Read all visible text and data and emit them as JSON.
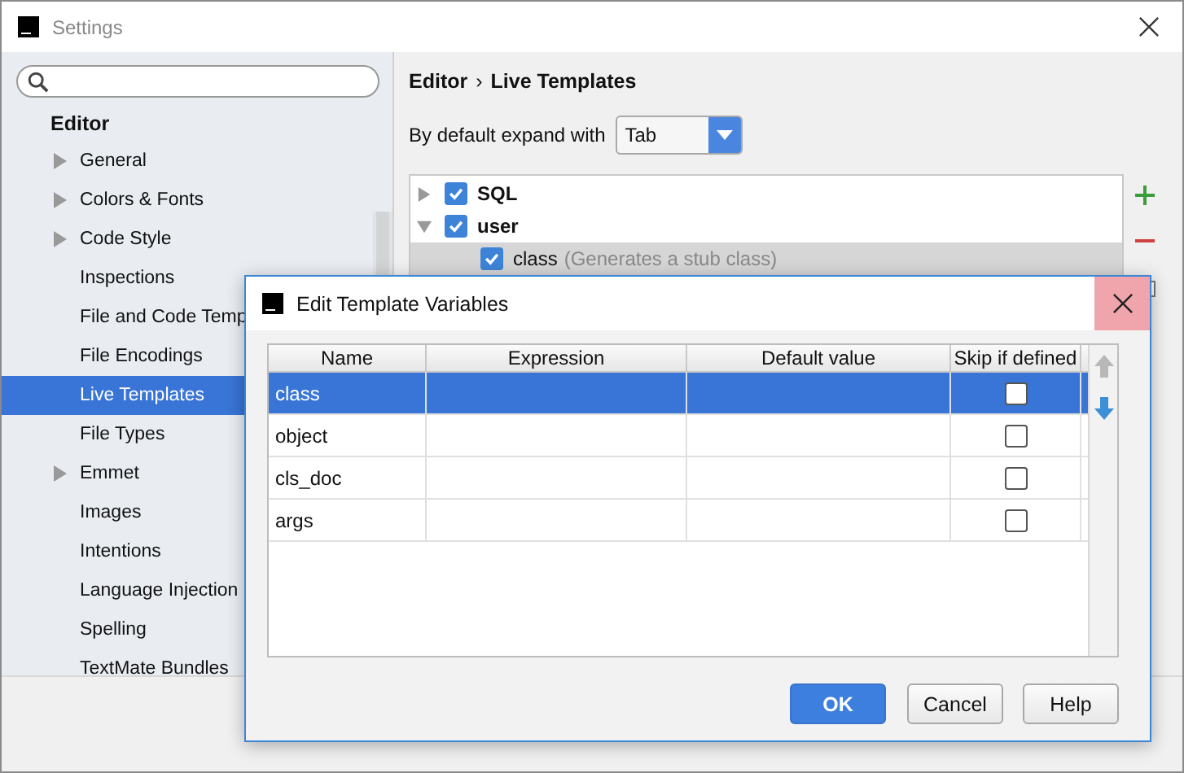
{
  "window": {
    "title": "Settings"
  },
  "sidebar": {
    "section": "Editor",
    "items": [
      {
        "label": "General",
        "expandable": true,
        "selected": false
      },
      {
        "label": "Colors & Fonts",
        "expandable": true,
        "selected": false
      },
      {
        "label": "Code Style",
        "expandable": true,
        "selected": false
      },
      {
        "label": "Inspections",
        "expandable": false,
        "selected": false
      },
      {
        "label": "File and Code Temp",
        "expandable": false,
        "selected": false
      },
      {
        "label": "File Encodings",
        "expandable": false,
        "selected": false
      },
      {
        "label": "Live Templates",
        "expandable": false,
        "selected": true
      },
      {
        "label": "File Types",
        "expandable": false,
        "selected": false
      },
      {
        "label": "Emmet",
        "expandable": true,
        "selected": false
      },
      {
        "label": "Images",
        "expandable": false,
        "selected": false
      },
      {
        "label": "Intentions",
        "expandable": false,
        "selected": false
      },
      {
        "label": "Language Injection",
        "expandable": false,
        "selected": false
      },
      {
        "label": "Spelling",
        "expandable": false,
        "selected": false
      },
      {
        "label": "TextMate Bundles",
        "expandable": false,
        "selected": false
      }
    ]
  },
  "breadcrumb": {
    "parent": "Editor",
    "separator": "›",
    "current": "Live Templates"
  },
  "expand_with": {
    "label": "By default expand with",
    "value": "Tab"
  },
  "templates": [
    {
      "name": "SQL",
      "checked": true,
      "expanded": false
    },
    {
      "name": "user",
      "checked": true,
      "expanded": true,
      "children": [
        {
          "name": "class",
          "description": "(Generates a stub class)",
          "checked": true,
          "selected": true
        }
      ]
    }
  ],
  "dialog": {
    "title": "Edit Template Variables",
    "columns": [
      "Name",
      "Expression",
      "Default value",
      "Skip if defined"
    ],
    "rows": [
      {
        "name": "class",
        "skip": false,
        "selected": true
      },
      {
        "name": "object",
        "skip": false,
        "selected": false
      },
      {
        "name": "cls_doc",
        "skip": false,
        "selected": false
      },
      {
        "name": "args",
        "skip": false,
        "selected": false
      }
    ],
    "buttons": [
      {
        "label": "OK",
        "default": true
      },
      {
        "label": "Cancel",
        "default": false
      },
      {
        "label": "Help",
        "default": false
      }
    ]
  }
}
